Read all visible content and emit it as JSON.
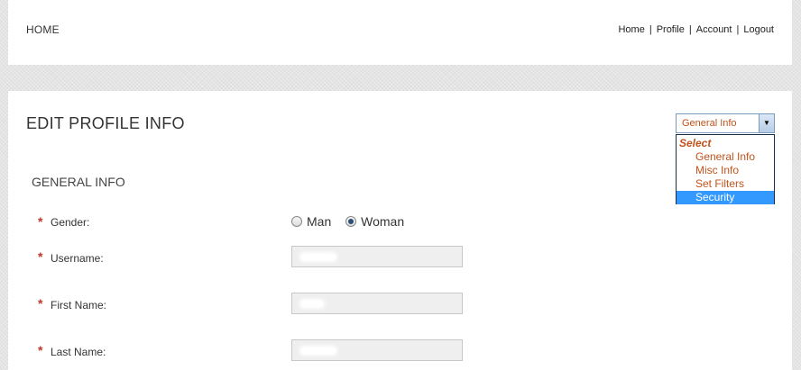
{
  "header": {
    "brand": "HOME",
    "nav": [
      "Home",
      "Profile",
      "Account",
      "Logout"
    ],
    "separator": "|"
  },
  "page": {
    "title": "EDIT PROFILE INFO",
    "section_title": "GENERAL INFO"
  },
  "section_select": {
    "value": "General Info",
    "options_group": "Select",
    "options": [
      "General Info",
      "Misc Info",
      "Set Filters",
      "Security"
    ],
    "highlighted": "Security"
  },
  "form": {
    "required_mark": "*",
    "gender": {
      "label": "Gender:",
      "options": [
        "Man",
        "Woman"
      ],
      "selected": "Woman"
    },
    "username": {
      "label": "Username:"
    },
    "first_name": {
      "label": "First Name:"
    },
    "last_name": {
      "label": "Last Name:"
    }
  },
  "colors": {
    "accent_orange": "#c0531c",
    "required_red": "#c0392b",
    "highlight_blue": "#3399ff"
  }
}
